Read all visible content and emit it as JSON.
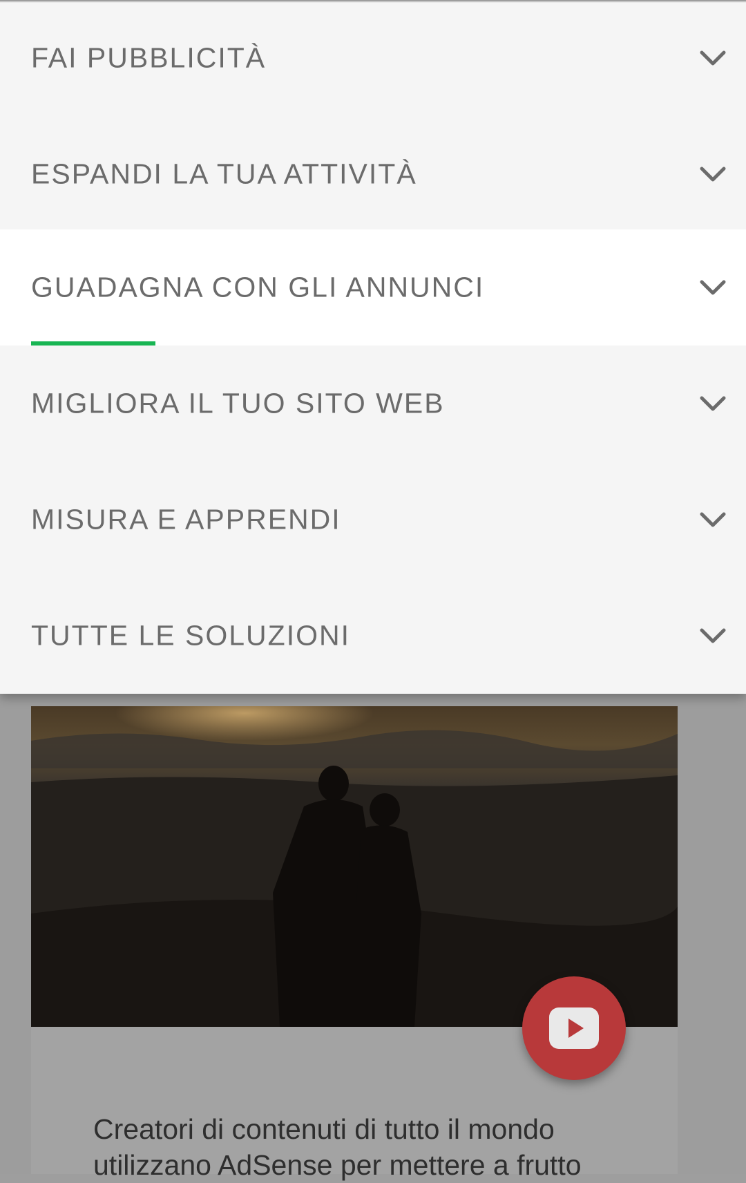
{
  "menu": {
    "items": [
      {
        "label": "FAI PUBBLICITÀ",
        "active": false
      },
      {
        "label": "ESPANDI LA TUA ATTIVITÀ",
        "active": false
      },
      {
        "label": "GUADAGNA CON GLI ANNUNCI",
        "active": true
      },
      {
        "label": "MIGLIORA IL TUO SITO WEB",
        "active": false
      },
      {
        "label": "MISURA E APPRENDI",
        "active": false
      },
      {
        "label": "TUTTE LE SOLUZIONI",
        "active": false
      }
    ],
    "chevron_icon": "chevron-down-icon",
    "active_indicator_color": "#18b553"
  },
  "content": {
    "card_text": "Creatori di contenuti di tutto il mondo utilizzano AdSense per mettere a frutto",
    "play_icon": "youtube-play-icon",
    "play_button_color": "#b8393a"
  }
}
